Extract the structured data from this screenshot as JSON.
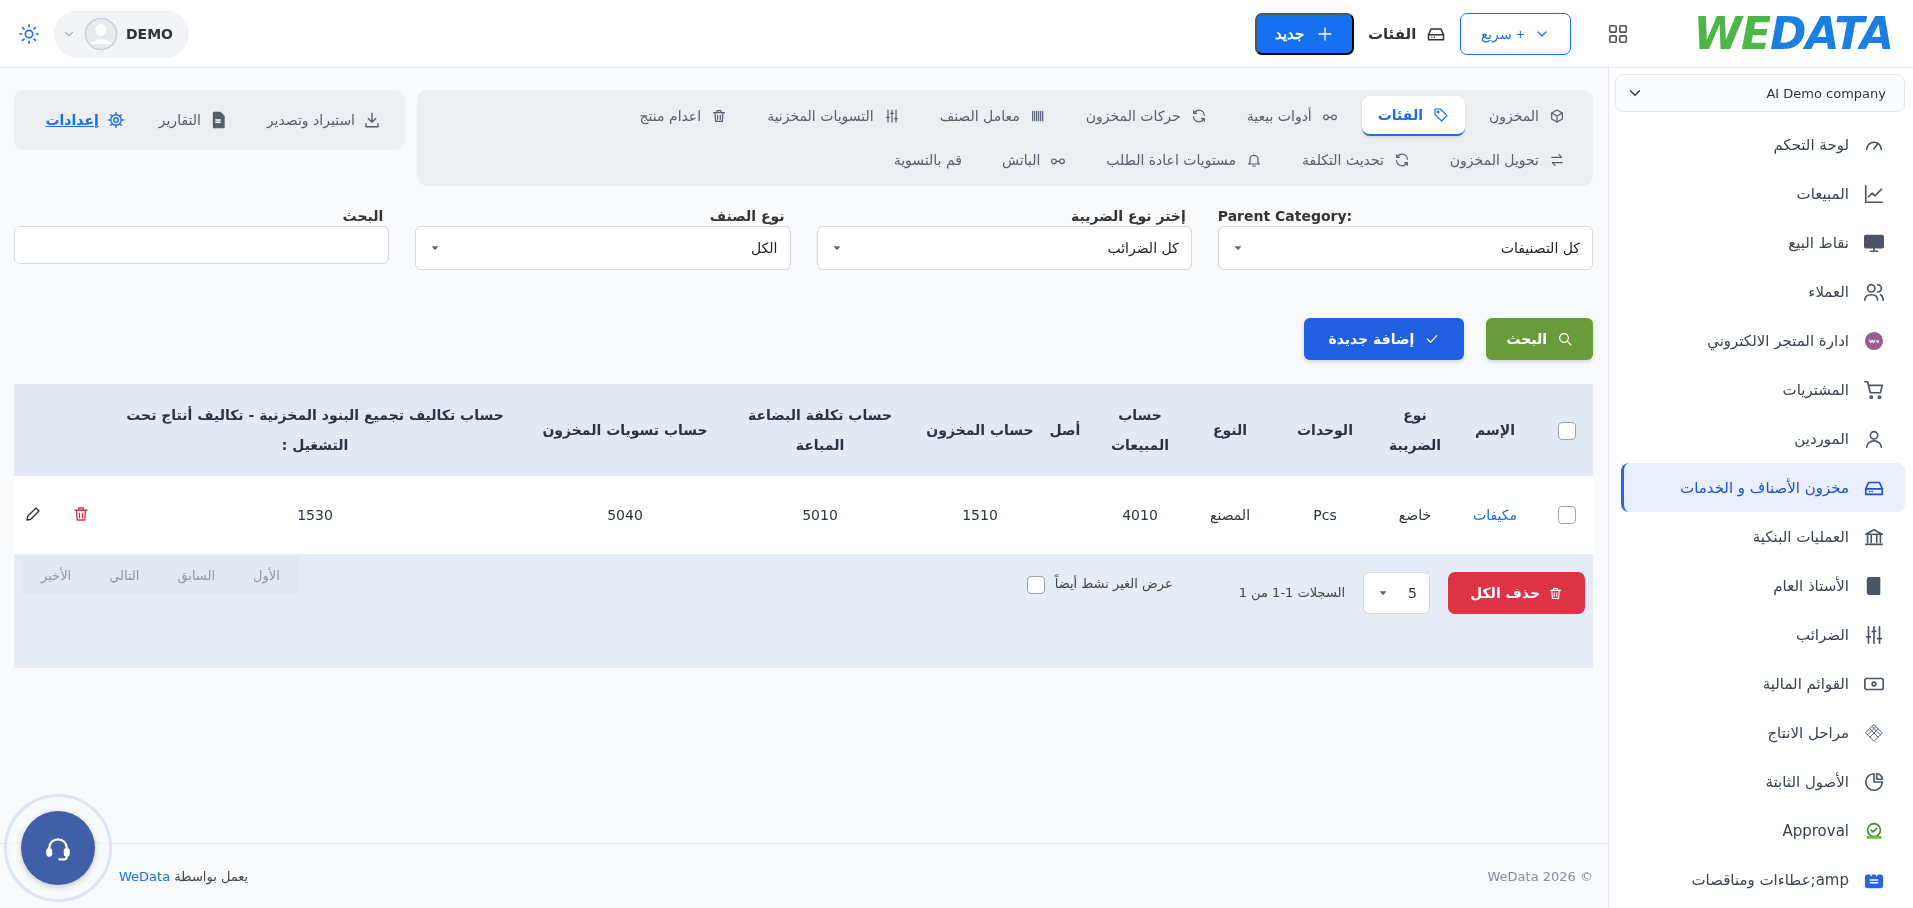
{
  "topbar": {
    "logo": {
      "part_1": "WE",
      "part_2": "DATA"
    },
    "quick_button": "+ سريع",
    "current_page": "الفئات",
    "new_button": "جديد",
    "user": {
      "name": "DEMO"
    }
  },
  "sidebar": {
    "company": "AI Demo company",
    "items": [
      {
        "label": "لوحة التحكم",
        "kind": "gauge",
        "selected": false
      },
      {
        "label": "المبيعات",
        "kind": "chart",
        "selected": false
      },
      {
        "label": "نقاط البيع",
        "kind": "monitor",
        "selected": false
      },
      {
        "label": "العملاء",
        "kind": "users",
        "selected": false
      },
      {
        "label": "ادارة المتجر الالكتروني",
        "kind": "woo",
        "selected": false
      },
      {
        "label": "المشتريات",
        "kind": "cart",
        "selected": false
      },
      {
        "label": "الموردين",
        "kind": "user",
        "selected": false
      },
      {
        "label": "مخزون الأصناف و الخدمات",
        "kind": "drive",
        "selected": true
      },
      {
        "label": "العمليات البنكية",
        "kind": "bank",
        "selected": false
      },
      {
        "label": "الأستاذ العام",
        "kind": "book",
        "selected": false
      },
      {
        "label": "الضرائب",
        "kind": "sliders",
        "selected": false
      },
      {
        "label": "القوائم المالية",
        "kind": "money",
        "selected": false
      },
      {
        "label": "مراحل الانتاج",
        "kind": "pattern",
        "selected": false
      },
      {
        "label": "الأصول الثابتة",
        "kind": "pie",
        "selected": false
      },
      {
        "label": "Approval",
        "kind": "badge",
        "selected": false
      },
      {
        "label": "amp;عطاءات ومناقصات",
        "kind": "briefcase",
        "selected": false
      }
    ]
  },
  "tab_rows": [
    {
      "tabs": [
        {
          "label": "المخزون",
          "kind": "cube",
          "selected": false
        },
        {
          "label": "الفئات",
          "kind": "tag",
          "selected": true
        },
        {
          "label": "أدوات بيعية",
          "kind": "glasses",
          "selected": false
        },
        {
          "label": "حركات المخزون",
          "kind": "refresh",
          "selected": false
        },
        {
          "label": "معامل الصنف",
          "kind": "barcode",
          "selected": false
        },
        {
          "label": "التسويات المخزنية",
          "kind": "sliders",
          "selected": false
        },
        {
          "label": "اعدام منتج",
          "kind": "trash",
          "selected": false
        }
      ]
    },
    {
      "tabs": [
        {
          "label": "تحويل المخزون",
          "kind": "swap",
          "selected": false
        },
        {
          "label": "تحديث التكلفة",
          "kind": "refresh",
          "selected": false
        },
        {
          "label": "مستويات اعادة الطلب",
          "kind": "bell",
          "selected": false
        },
        {
          "label": "الباتش",
          "kind": "glasses",
          "selected": false
        },
        {
          "label": "قم بالتسوية",
          "kind": "plain",
          "selected": false
        }
      ]
    }
  ],
  "tools": [
    {
      "label": "استيراد وتصدير",
      "kind": "download"
    },
    {
      "label": "التقارير",
      "kind": "pdf"
    },
    {
      "label": "إعدادات",
      "kind": "gear"
    }
  ],
  "filters": [
    {
      "label": "Parent Category:",
      "kind": "select",
      "value": "كل التصنيفات"
    },
    {
      "label": "إختر نوع الضريبة",
      "kind": "select",
      "value": "كل الضرائب"
    },
    {
      "label": "نوع الصنف",
      "kind": "select",
      "value": "الكل"
    },
    {
      "label": "البحث",
      "kind": "text"
    }
  ],
  "actions": {
    "search_button": "البحث",
    "add_button": "إضافة جديدة"
  },
  "table": {
    "header_checkbox": {
      "checked": false
    },
    "columns": [
      "الإسم",
      "نوع الضريبة",
      "الوحدات",
      "النوع",
      "حساب المبيعات",
      "أصل",
      "حساب المخزون",
      "حساب تكلفة البضاعة المباعة",
      "حساب تسويات المخزون",
      "حساب تكاليف تجميع البنود المخزنية - تكاليف أنتاج تحت التشغيل :"
    ],
    "rows": [
      {
        "checked": false,
        "cells": [
          "مكيفات",
          "خاضع",
          "Pcs",
          "المصنع",
          "4010",
          null,
          "1510",
          "5010",
          "5040",
          "1530"
        ]
      }
    ],
    "delete_all_button": "حذف الكل",
    "page_size": "5",
    "records": "السجلات 1-1 من 1",
    "show_inactive": {
      "label": "عرض الغير نشط أيضاً",
      "checked": false
    },
    "pagination": [
      {
        "label": "الأول",
        "disabled": true
      },
      {
        "label": "السابق",
        "disabled": true
      },
      {
        "label": "التالي",
        "disabled": true
      },
      {
        "label": "الأخير",
        "disabled": true
      }
    ]
  },
  "footer": {
    "copyright": "WeData 2026 ©",
    "powered_by": "يعمل بواسطة",
    "powered_link": "WeData"
  }
}
